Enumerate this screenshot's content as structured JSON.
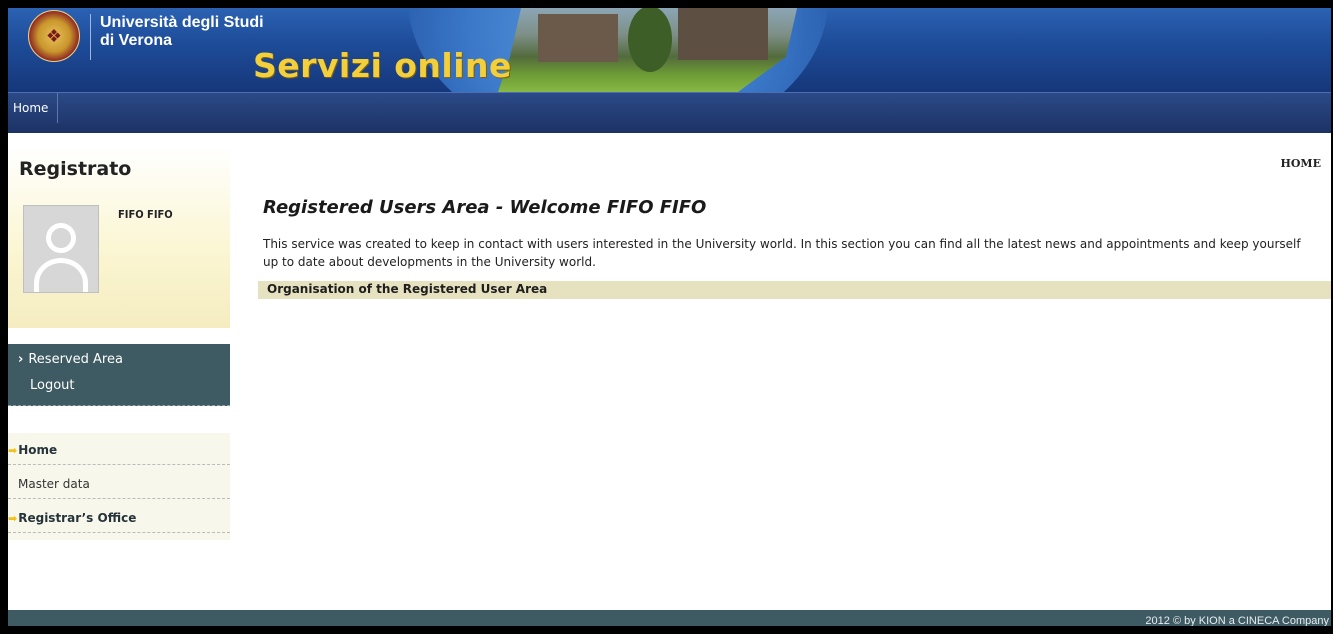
{
  "header": {
    "logo_glyph": "❖",
    "university_name": "Università degli Studi\ndi Verona",
    "service_title": "Servizi online"
  },
  "topnav": {
    "items": [
      {
        "label": "Home"
      }
    ]
  },
  "sidebar": {
    "user_box": {
      "title": "Registrato",
      "user_name": "FIFO FIFO"
    },
    "reserved_menu": {
      "items": [
        {
          "label": "Reserved Area",
          "chevron": "›"
        },
        {
          "label": "Logout"
        }
      ]
    },
    "nav_menu": {
      "items": [
        {
          "label": "Home",
          "arrow": "➡"
        },
        {
          "label": "Master data"
        },
        {
          "label": "Registrar’s Office",
          "arrow": "➡"
        }
      ]
    }
  },
  "main": {
    "breadcrumb": "HOME",
    "title": "Registered Users Area - Welcome FIFO FIFO",
    "description": "This service was created to keep in contact with users interested in the University world. In this section you can find all the latest news and appointments and keep yourself up to date about developments in the University world.",
    "section_label": "Organisation of the Registered User Area"
  },
  "footer": {
    "text": "2012 © by KION a CINECA Company"
  },
  "colors": {
    "banner_blue": "#1e4d9a",
    "nav_blue": "#1c3265",
    "sidebar_dark": "#3e5a63",
    "title_yellow": "#f3cf3c",
    "arrow_yellow": "#f2c21a",
    "section_bar": "#e6e2c0"
  }
}
